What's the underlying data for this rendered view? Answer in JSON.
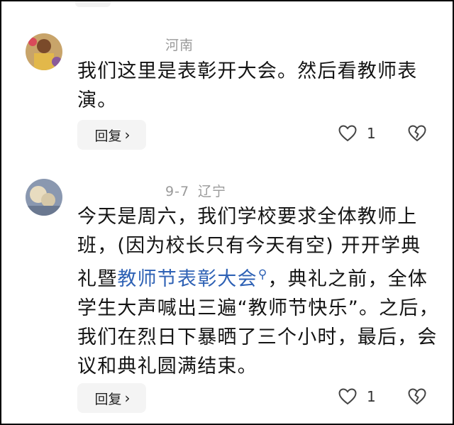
{
  "comments": [
    {
      "date": "",
      "location": "河南",
      "text": "我们这里是表彰开大会。然后看教师表演。",
      "reply_label": "回复",
      "like_count": "1",
      "avatar": "user-avatar-photo",
      "icons": [
        "heart-icon",
        "broken-heart-icon",
        "chevron-right-icon"
      ]
    },
    {
      "date": "9-7",
      "location": "辽宁",
      "text_before": "今天是周六，我们学校要求全体教师上班，(因为校长只有今天有空) 开开学典礼暨",
      "link_text": "教师节表彰大会",
      "text_after": "，典礼之前，全体学生大声喊出三遍“教师节快乐”。之后，我们在烈日下暴晒了三个小时，最后，会议和典礼圆满结束。",
      "reply_label": "回复",
      "like_count": "1",
      "avatar": "user-avatar-photo",
      "icons": [
        "search-icon",
        "heart-icon",
        "broken-heart-icon",
        "chevron-right-icon"
      ]
    }
  ],
  "colors": {
    "link": "#2f62b5",
    "meta": "#9a9a9a",
    "button_bg": "#f4f4f4"
  }
}
